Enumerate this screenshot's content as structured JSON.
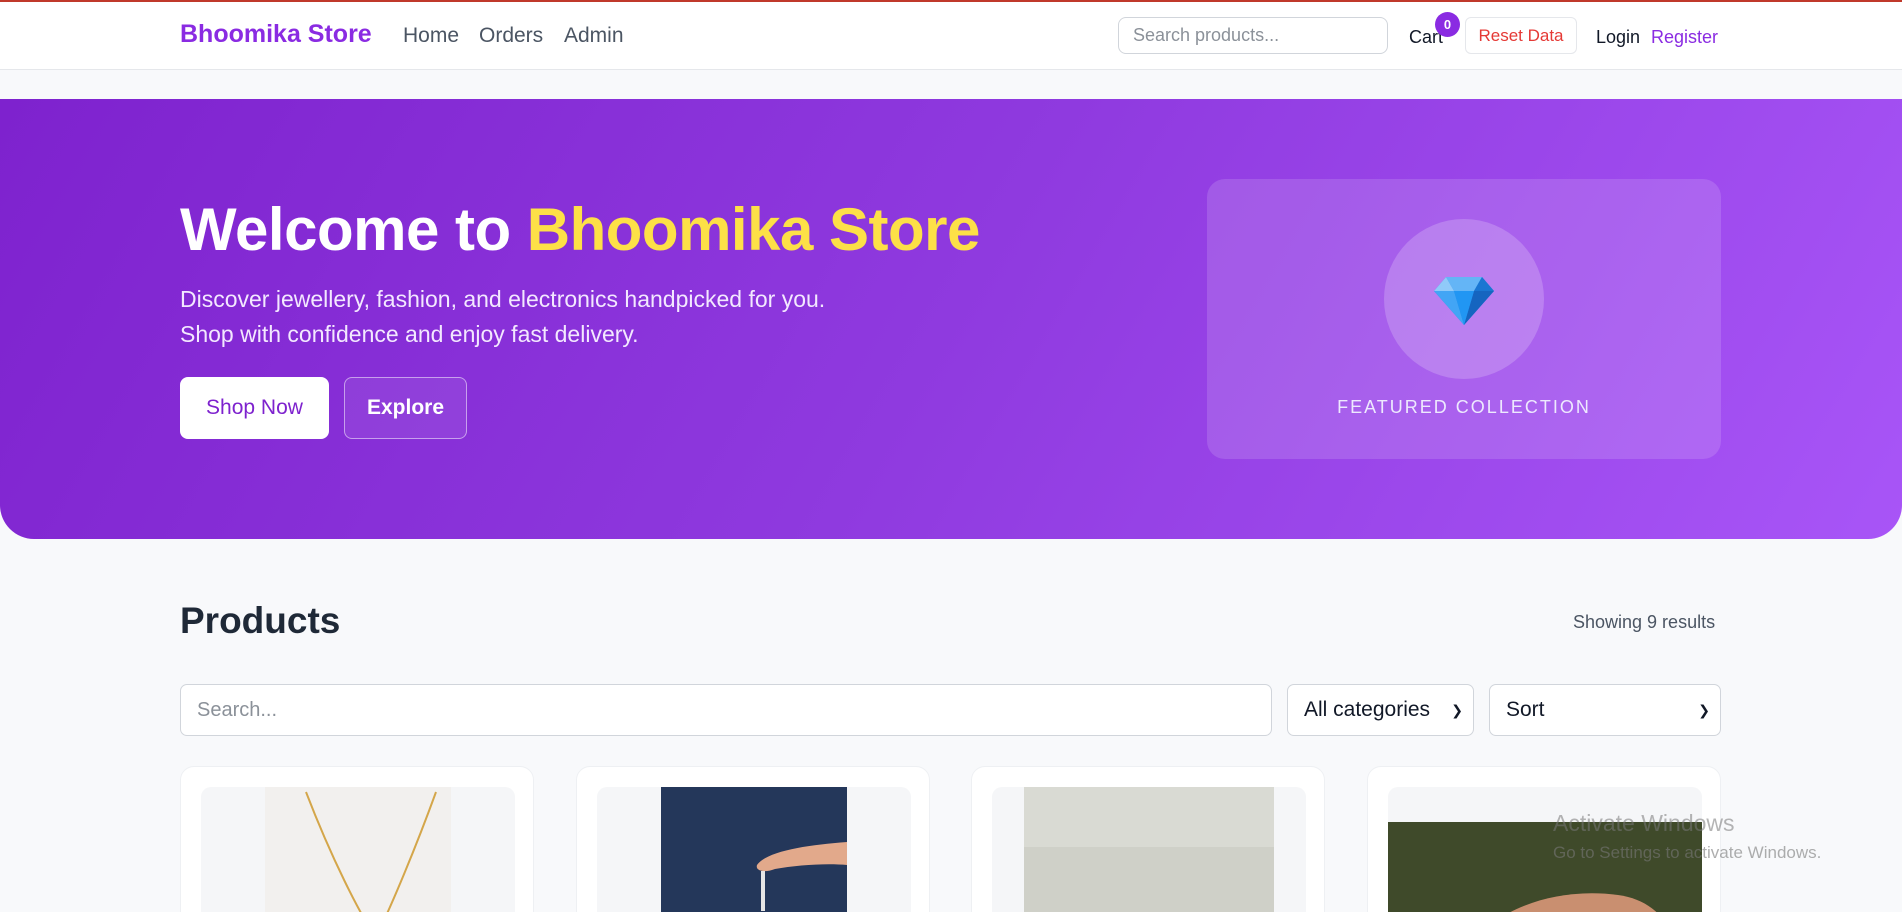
{
  "navbar": {
    "brand": "Bhoomika Store",
    "links": [
      "Home",
      "Orders",
      "Admin"
    ],
    "search_placeholder": "Search products...",
    "cart_label": "Cart",
    "cart_count": "0",
    "reset_label": "Reset Data",
    "login_label": "Login",
    "register_label": "Register"
  },
  "hero": {
    "title_prefix": "Welcome to ",
    "title_highlight": "Bhoomika Store",
    "subtitle_line1": "Discover jewellery, fashion, and electronics handpicked for you.",
    "subtitle_line2": "Shop with confidence and enjoy fast delivery.",
    "shop_button": "Shop Now",
    "explore_button": "Explore",
    "featured_label": "FEATURED COLLECTION",
    "featured_icon": "gem-icon"
  },
  "products": {
    "title": "Products",
    "results_text": "Showing 9 results",
    "search_placeholder": "Search...",
    "category_selected": "All categories",
    "sort_selected": "Sort"
  },
  "colors": {
    "brand": "#8a2be2",
    "highlight": "#fde047",
    "reset": "#e53935"
  },
  "watermark": {
    "line1": "Activate Windows",
    "line2": "Go to Settings to activate Windows."
  }
}
